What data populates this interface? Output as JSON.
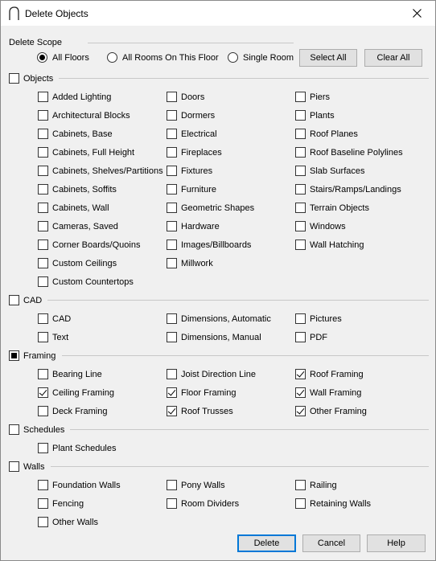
{
  "window": {
    "title": "Delete Objects",
    "app_icon": "arch-icon",
    "close_icon": "close-icon"
  },
  "scope": {
    "label": "Delete Scope",
    "options": [
      {
        "label": "All Floors",
        "selected": true
      },
      {
        "label": "All Rooms On This Floor",
        "selected": false
      },
      {
        "label": "Single Room",
        "selected": false
      }
    ],
    "select_all": "Select All",
    "clear_all": "Clear All"
  },
  "groups": {
    "objects": {
      "label": "Objects",
      "state": "unchecked",
      "items": [
        {
          "label": "Added Lighting",
          "checked": false
        },
        {
          "label": "Architectural Blocks",
          "checked": false
        },
        {
          "label": "Cabinets, Base",
          "checked": false
        },
        {
          "label": "Cabinets, Full Height",
          "checked": false
        },
        {
          "label": "Cabinets, Shelves/Partitions",
          "checked": false
        },
        {
          "label": "Cabinets, Soffits",
          "checked": false
        },
        {
          "label": "Cabinets, Wall",
          "checked": false
        },
        {
          "label": "Cameras, Saved",
          "checked": false
        },
        {
          "label": "Corner Boards/Quoins",
          "checked": false
        },
        {
          "label": "Custom Ceilings",
          "checked": false
        },
        {
          "label": "Custom Countertops",
          "checked": false
        },
        {
          "label": "Doors",
          "checked": false
        },
        {
          "label": "Dormers",
          "checked": false
        },
        {
          "label": "Electrical",
          "checked": false
        },
        {
          "label": "Fireplaces",
          "checked": false
        },
        {
          "label": "Fixtures",
          "checked": false
        },
        {
          "label": "Furniture",
          "checked": false
        },
        {
          "label": "Geometric Shapes",
          "checked": false
        },
        {
          "label": "Hardware",
          "checked": false
        },
        {
          "label": "Images/Billboards",
          "checked": false
        },
        {
          "label": "Millwork",
          "checked": false
        },
        {
          "label": "Piers",
          "checked": false
        },
        {
          "label": "Plants",
          "checked": false
        },
        {
          "label": "Roof Planes",
          "checked": false
        },
        {
          "label": "Roof Baseline Polylines",
          "checked": false
        },
        {
          "label": "Slab Surfaces",
          "checked": false
        },
        {
          "label": "Stairs/Ramps/Landings",
          "checked": false
        },
        {
          "label": "Terrain Objects",
          "checked": false
        },
        {
          "label": "Windows",
          "checked": false
        },
        {
          "label": "Wall Hatching",
          "checked": false
        }
      ]
    },
    "cad": {
      "label": "CAD",
      "state": "unchecked",
      "items": [
        {
          "label": "CAD",
          "checked": false
        },
        {
          "label": "Text",
          "checked": false
        },
        {
          "label": "Dimensions, Automatic",
          "checked": false
        },
        {
          "label": "Dimensions, Manual",
          "checked": false
        },
        {
          "label": "Pictures",
          "checked": false
        },
        {
          "label": "PDF",
          "checked": false
        }
      ]
    },
    "framing": {
      "label": "Framing",
      "state": "partial",
      "items": [
        {
          "label": "Bearing Line",
          "checked": false
        },
        {
          "label": "Ceiling Framing",
          "checked": true
        },
        {
          "label": "Deck Framing",
          "checked": false
        },
        {
          "label": "Joist Direction Line",
          "checked": false
        },
        {
          "label": "Floor Framing",
          "checked": true
        },
        {
          "label": "Roof Trusses",
          "checked": true
        },
        {
          "label": "Roof Framing",
          "checked": true
        },
        {
          "label": "Wall Framing",
          "checked": true
        },
        {
          "label": "Other Framing",
          "checked": true
        }
      ]
    },
    "schedules": {
      "label": "Schedules",
      "state": "unchecked",
      "items": [
        {
          "label": "Plant Schedules",
          "checked": false
        }
      ]
    },
    "walls": {
      "label": "Walls",
      "state": "unchecked",
      "items": [
        {
          "label": "Foundation Walls",
          "checked": false
        },
        {
          "label": "Fencing",
          "checked": false
        },
        {
          "label": "Other Walls",
          "checked": false
        },
        {
          "label": "Pony Walls",
          "checked": false
        },
        {
          "label": "Room Dividers",
          "checked": false
        },
        {
          "label": "Railing",
          "checked": false
        },
        {
          "label": "Retaining Walls",
          "checked": false
        }
      ]
    }
  },
  "footer": {
    "delete": "Delete",
    "cancel": "Cancel",
    "help": "Help"
  }
}
